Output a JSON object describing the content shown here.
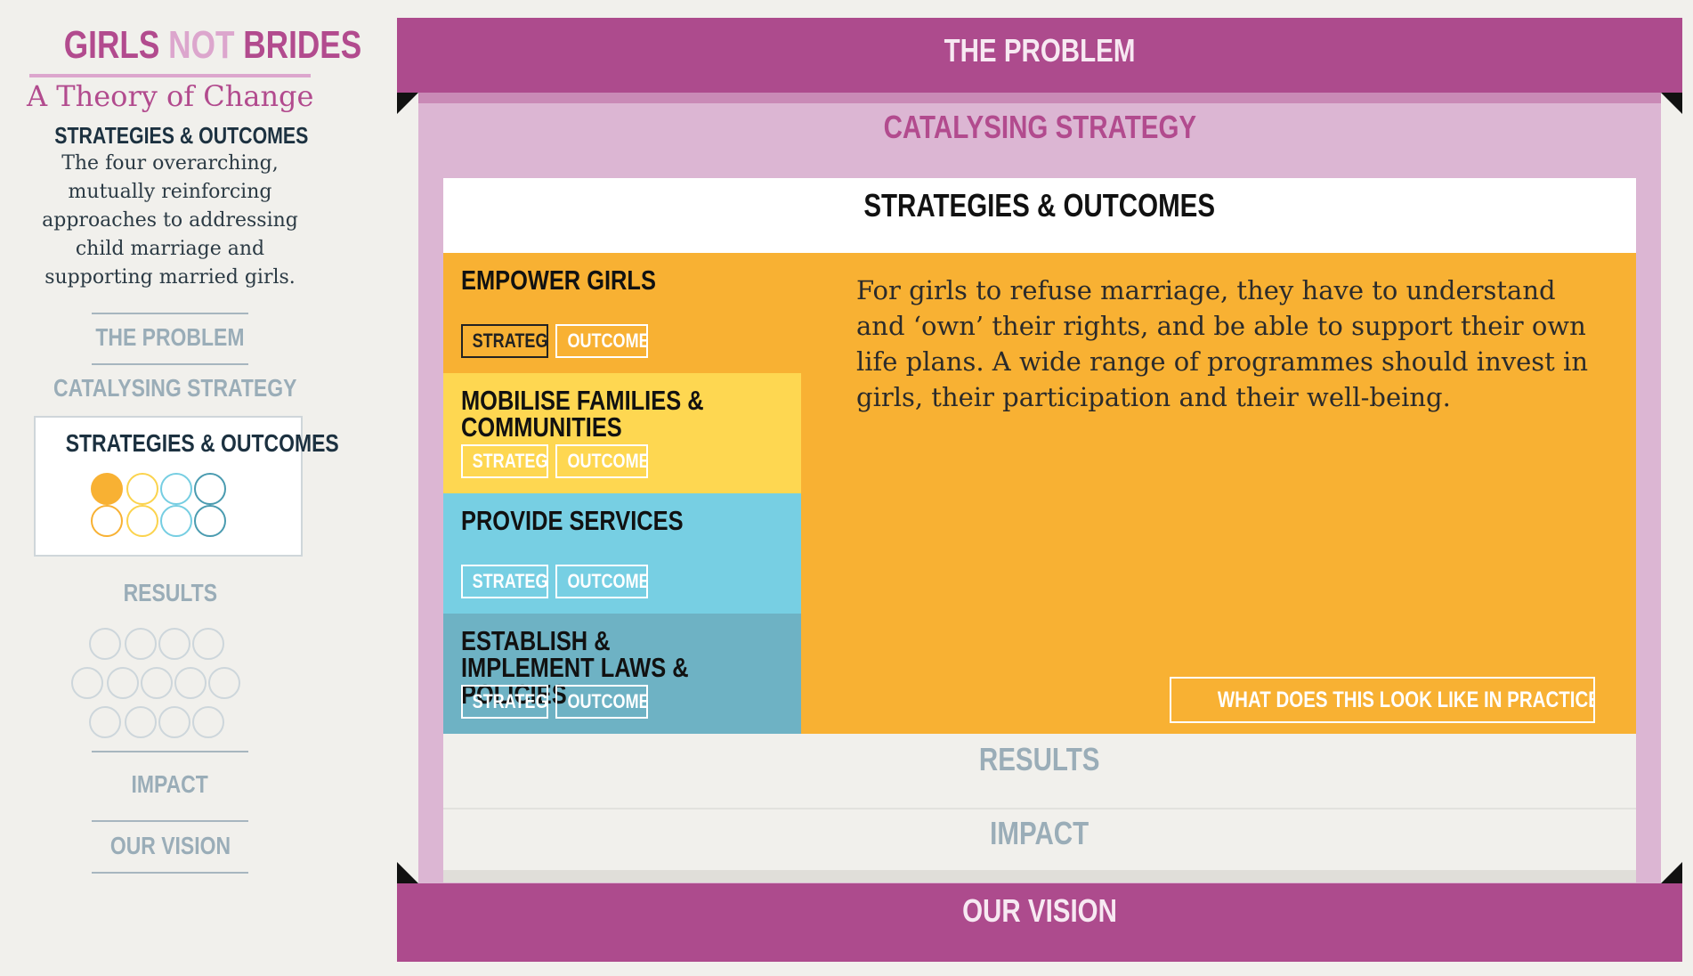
{
  "sidebar": {
    "logo": {
      "part1": "GIRLS",
      "part2": "NOT",
      "part3": "BRIDES"
    },
    "tagline": "A Theory of Change",
    "heading": "STRATEGIES & OUTCOMES",
    "description": "The four overarching, mutually reinforcing approaches to addressing child marriage and supporting married girls.",
    "nav": {
      "problem": "THE PROBLEM",
      "catalysing": "CATALYSING STRATEGY",
      "strategies": "STRATEGIES & OUTCOMES",
      "results": "RESULTS",
      "impact": "IMPACT",
      "vision": "OUR VISION"
    },
    "strategy_dot_colors": [
      "#f8b133",
      "#fbd34d",
      "#76cee2",
      "#4a9bb0"
    ]
  },
  "main": {
    "problem": "THE PROBLEM",
    "catalysing": "CATALYSING STRATEGY",
    "strategies_header": "STRATEGIES & OUTCOMES",
    "strategies": [
      {
        "title": "EMPOWER GIRLS",
        "color": "#f8b133",
        "active": true
      },
      {
        "title": "MOBILISE FAMILIES & COMMUNITIES",
        "color": "#fed751",
        "active": false
      },
      {
        "title": "PROVIDE SERVICES",
        "color": "#77cfe3",
        "active": false
      },
      {
        "title": "ESTABLISH & IMPLEMENT LAWS & POLICIES",
        "color": "#6eb2c4",
        "active": false
      }
    ],
    "tag_strategy": "STRATEGY",
    "tag_outcomes": "OUTCOMES",
    "description": "For girls to refuse marriage, they have to understand and ‘own’ their rights, and be able to support their own life plans. A wide range of programmes should invest in girls, their participation and their well-being.",
    "practice_button": "WHAT DOES THIS LOOK LIKE IN PRACTICE? >>",
    "results": "RESULTS",
    "impact": "IMPACT",
    "vision": "OUR VISION"
  },
  "colors": {
    "brand_magenta": "#ad4b8d",
    "brand_pink": "#dcb6d3",
    "muted_nav": "#9aadb8"
  }
}
